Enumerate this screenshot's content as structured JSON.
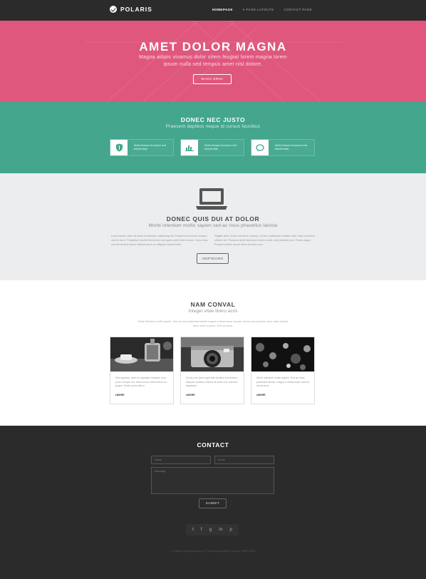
{
  "header": {
    "logo_text": "POLARIS",
    "nav": [
      {
        "label": "HOMEPAGE"
      },
      {
        "label": "PAGE LAYOUTS"
      },
      {
        "label": "CONTACT PAGE"
      }
    ]
  },
  "hero": {
    "title": "AMET DOLOR MAGNA",
    "subtitle": "Magna adipis vivamus dolor sitem feugiat lorem magna lorem ipsum nulla sed tempus amet nisl dolore.",
    "button": "MAGS ORNA"
  },
  "features": {
    "title": "DONEC NEC JUSTO",
    "subtitle": "Praesent dapibus neque id cursus faucibus",
    "items": [
      {
        "icon": "shield-icon",
        "text": "Morbi tempus leo ipsum sed blandit vitae."
      },
      {
        "icon": "bar-chart-icon",
        "text": "Morbi tempus leo ipsum sed blandit vitae."
      },
      {
        "icon": "chat-bubble-icon",
        "text": "Morbi tempus leo ipsum sed blandit vitae."
      }
    ]
  },
  "about": {
    "title": "DONEC QUIS DUI AT DOLOR",
    "subtitle": "Morbi interdum mollis sapien sed ac risus phasellus lacinia",
    "col1": "Lorem ipsum dolor sit amet consectetur adipiscing elit. Praesent sed lorem tempor, viverra nunc. Phasellus lobortis fermentum dui quam amet lorem luctus. Nunc risus non fermentum lacus. Maecenas ac eu aliquam lacinia tortor.",
    "col2": "Sagittis ante, lectus elit lacus vivamus. Ut sed vestibulum tristique nibh. Nam hendrerit ultrices vel. Praesent amet bibendum viverra nulla, sed pharetra erat. Fusce augue. Praesent lorem ipsum dolor sit amet urna.",
    "button": "ADIPISCING"
  },
  "gallery": {
    "title": "NAM CONVAL",
    "subtitle": "Integer vitae libero acris",
    "intro": "Morbi interdum mollis sapien. Sed ac risus phasellus lacinia magna a ullamcorper laoreet, lectus arcu pulvinar risus, vitae facilisis libero dolor a purus. Sed vel lacus.",
    "cards": [
      {
        "text": "Sed egestas, ante et vulputate volutpat, eros pede semper est, vitae luctus metus libero eu augue. Morbi purus libero.",
        "more": "MORE"
      },
      {
        "text": "Donec nec justo eget felis facilisis fermentum. Aliquam porttitor mauris sit amet orci. Aenean dignissim.",
        "more": "MORE"
      },
      {
        "text": "Morbi interdum mollis sapien. Sed ac risus phasellus lacinia, magna a ullamcorper laoreet, lectus arcu.",
        "more": "MORE"
      }
    ]
  },
  "contact": {
    "title": "CONTACT",
    "name_placeholder": "Name",
    "email_placeholder": "Email",
    "message_placeholder": "Message",
    "submit": "SUBMIT",
    "social": [
      "t",
      "f",
      "g",
      "in",
      "p"
    ],
    "copyright": "© Untitled. All rights reserved. | Photos by Unsplash | Design: TEMPLATED"
  },
  "colors": {
    "hero": "#e0577d",
    "teal": "#43a68d",
    "gray": "#ecedef",
    "dark": "#2b2b2b"
  }
}
